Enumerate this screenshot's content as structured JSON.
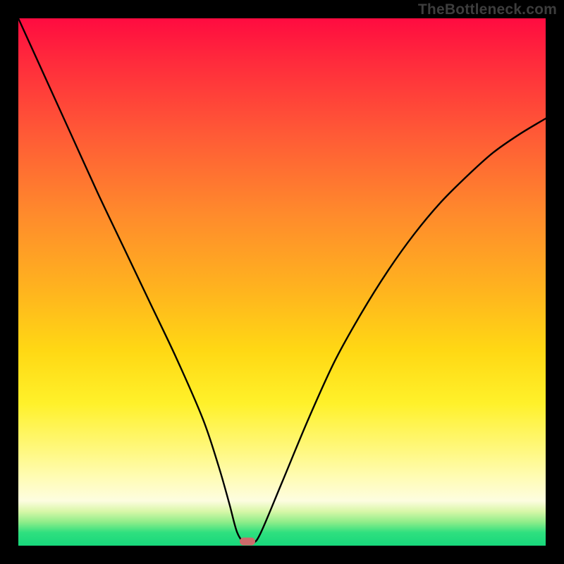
{
  "watermark": "TheBottleneck.com",
  "marker": {
    "x_frac": 0.435,
    "y_frac": 0.992
  },
  "chart_data": {
    "type": "line",
    "title": "",
    "xlabel": "",
    "ylabel": "",
    "xlim": [
      0,
      100
    ],
    "ylim": [
      0,
      100
    ],
    "series": [
      {
        "name": "curve",
        "x": [
          0,
          5,
          10,
          15,
          20,
          25,
          30,
          35,
          38,
          40,
          41.5,
          43,
          44.5,
          46,
          50,
          55,
          60,
          65,
          70,
          75,
          80,
          85,
          90,
          95,
          100
        ],
        "y": [
          100,
          89,
          78,
          67,
          56.5,
          46,
          35.5,
          24,
          15,
          8,
          2.5,
          0.5,
          0.5,
          2.5,
          12,
          24,
          35,
          44,
          52,
          59,
          65,
          70,
          74.5,
          78,
          81
        ]
      }
    ],
    "marker_text": ""
  }
}
